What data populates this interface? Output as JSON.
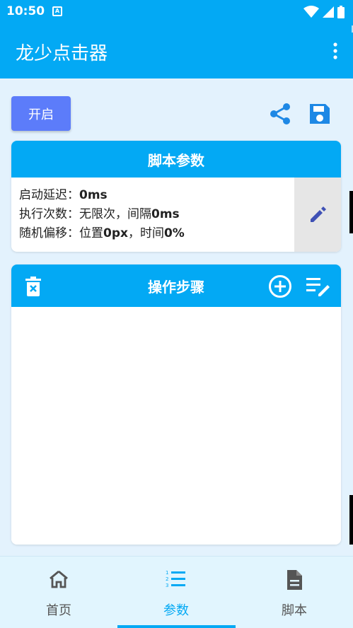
{
  "status_bar": {
    "time": "10:50",
    "notif_glyph": "A"
  },
  "app_bar": {
    "title": "龙少点击器"
  },
  "toolbar": {
    "start_label": "开启"
  },
  "params_card": {
    "title": "脚本参数",
    "lines": [
      {
        "label": "启动延迟：",
        "value": "0ms"
      },
      {
        "label": "执行次数：无限次，间隔",
        "value": "0ms"
      },
      {
        "label": "随机偏移：位置",
        "value": "0px",
        "label2": "，时间",
        "value2": "0%"
      }
    ]
  },
  "steps_card": {
    "title": "操作步骤"
  },
  "bottom_nav": {
    "items": [
      {
        "label": "首页",
        "icon": "home-icon"
      },
      {
        "label": "参数",
        "icon": "list-numbered-icon"
      },
      {
        "label": "脚本",
        "icon": "document-icon"
      }
    ],
    "active_index": 1
  },
  "colors": {
    "primary": "#03a9f4",
    "accent": "#5c7cfa",
    "background": "#e3f2fd"
  }
}
